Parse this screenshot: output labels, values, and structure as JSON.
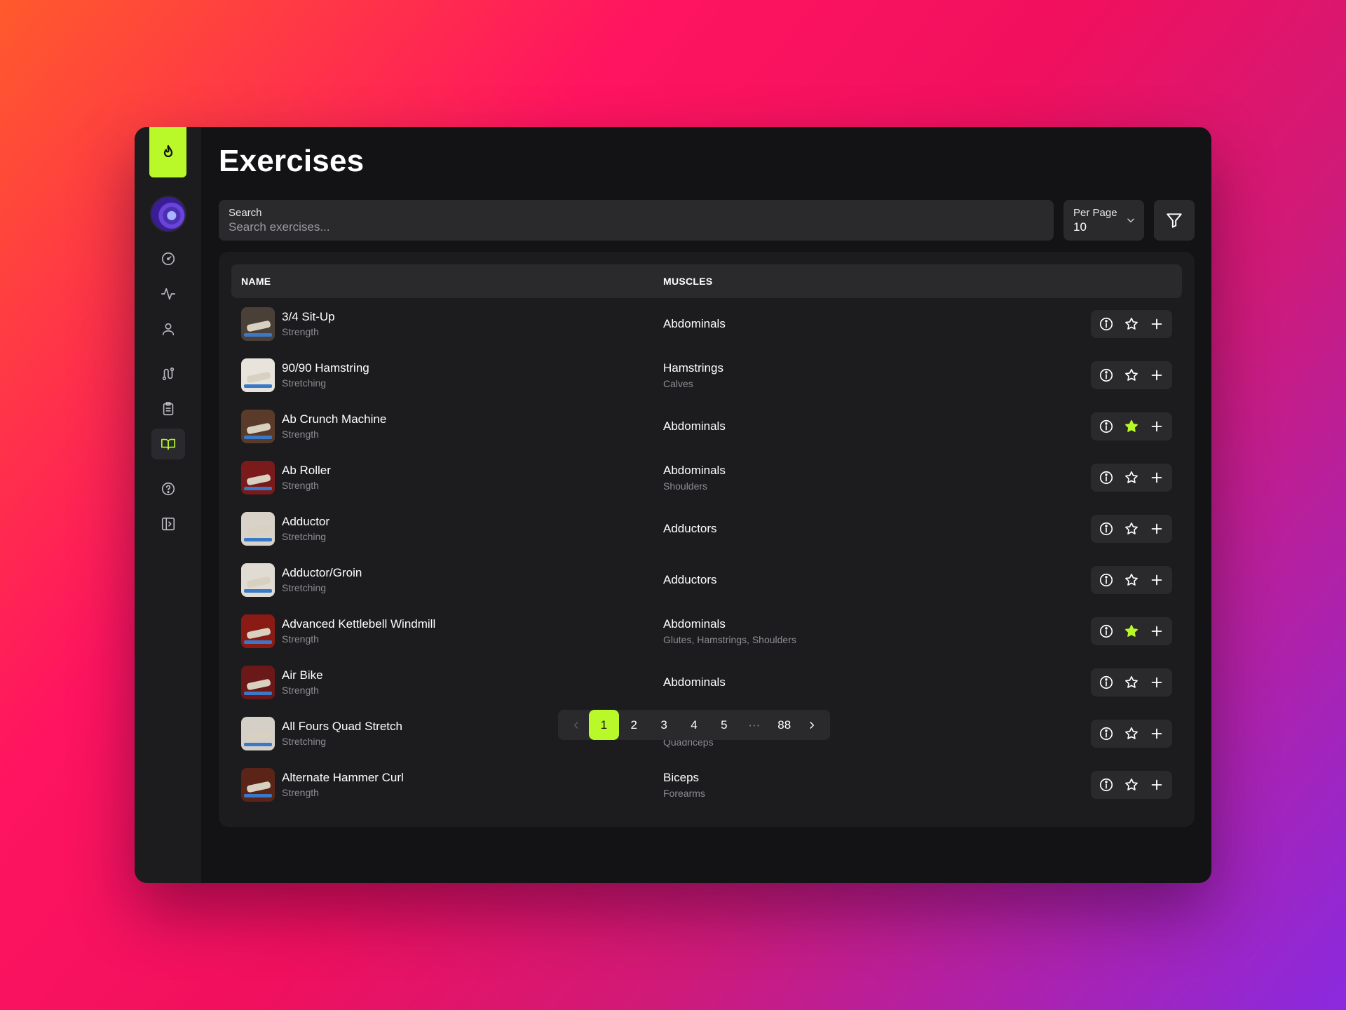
{
  "page": {
    "title": "Exercises"
  },
  "search": {
    "label": "Search",
    "placeholder": "Search exercises..."
  },
  "per_page": {
    "label": "Per Page",
    "value": "10"
  },
  "table": {
    "headers": {
      "name": "NAME",
      "muscles": "MUSCLES"
    },
    "rows": [
      {
        "name": "3/4 Sit-Up",
        "category": "Strength",
        "primary": "Abdominals",
        "secondary": "",
        "favorite": false
      },
      {
        "name": "90/90 Hamstring",
        "category": "Stretching",
        "primary": "Hamstrings",
        "secondary": "Calves",
        "favorite": false
      },
      {
        "name": "Ab Crunch Machine",
        "category": "Strength",
        "primary": "Abdominals",
        "secondary": "",
        "favorite": true
      },
      {
        "name": "Ab Roller",
        "category": "Strength",
        "primary": "Abdominals",
        "secondary": "Shoulders",
        "favorite": false
      },
      {
        "name": "Adductor",
        "category": "Stretching",
        "primary": "Adductors",
        "secondary": "",
        "favorite": false
      },
      {
        "name": "Adductor/Groin",
        "category": "Stretching",
        "primary": "Adductors",
        "secondary": "",
        "favorite": false
      },
      {
        "name": "Advanced Kettlebell Windmill",
        "category": "Strength",
        "primary": "Abdominals",
        "secondary": "Glutes, Hamstrings, Shoulders",
        "favorite": true
      },
      {
        "name": "Air Bike",
        "category": "Strength",
        "primary": "Abdominals",
        "secondary": "",
        "favorite": false
      },
      {
        "name": "All Fours Quad Stretch",
        "category": "Stretching",
        "primary": "Quadriceps",
        "secondary": "Quadriceps",
        "favorite": false
      },
      {
        "name": "Alternate Hammer Curl",
        "category": "Strength",
        "primary": "Biceps",
        "secondary": "Forearms",
        "favorite": false
      }
    ]
  },
  "pagination": {
    "pages": [
      "1",
      "2",
      "3",
      "4",
      "5"
    ],
    "ellipsis": "···",
    "last": "88",
    "current": "1"
  },
  "sidebar": {
    "items": [
      {
        "icon": "dashboard-icon"
      },
      {
        "icon": "activity-icon"
      },
      {
        "icon": "user-icon"
      },
      {
        "icon": "route-icon"
      },
      {
        "icon": "clipboard-icon"
      },
      {
        "icon": "book-icon",
        "active": true
      },
      {
        "icon": "help-icon"
      },
      {
        "icon": "sidebar-toggle-icon"
      }
    ]
  },
  "colors": {
    "accent": "#b9f92a",
    "window": "#131315",
    "panel": "#1c1c1f",
    "control": "#2a2a2d"
  }
}
